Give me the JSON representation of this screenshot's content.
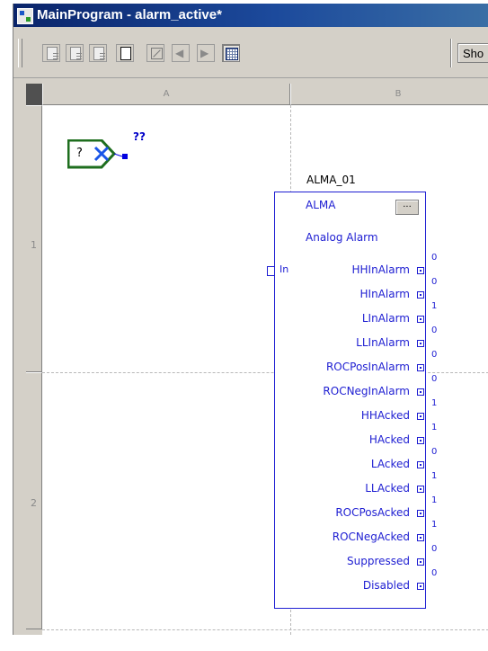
{
  "window": {
    "title": "MainProgram - alarm_active*"
  },
  "toolbar": {
    "show_label": "Sho"
  },
  "grid": {
    "columns": [
      "A",
      "B"
    ],
    "rows": [
      "1",
      "2"
    ]
  },
  "input_reference": {
    "value": "?",
    "tag_placeholder": "??"
  },
  "block": {
    "instance_name": "ALMA_01",
    "type": "ALMA",
    "ellipsis": "...",
    "description": "Analog Alarm",
    "input_pin": "In",
    "outputs": [
      {
        "label": "HHInAlarm",
        "value": "0"
      },
      {
        "label": "HInAlarm",
        "value": "0"
      },
      {
        "label": "LInAlarm",
        "value": "1"
      },
      {
        "label": "LLInAlarm",
        "value": "0"
      },
      {
        "label": "ROCPosInAlarm",
        "value": "0"
      },
      {
        "label": "ROCNegInAlarm",
        "value": "0"
      },
      {
        "label": "HHAcked",
        "value": "1"
      },
      {
        "label": "HAcked",
        "value": "1"
      },
      {
        "label": "LAcked",
        "value": "0"
      },
      {
        "label": "LLAcked",
        "value": "1"
      },
      {
        "label": "ROCPosAcked",
        "value": "1"
      },
      {
        "label": "ROCNegAcked",
        "value": "1"
      },
      {
        "label": "Suppressed",
        "value": "0"
      },
      {
        "label": "Disabled",
        "value": "0"
      }
    ]
  },
  "colors": {
    "title_bar": "#0a246a",
    "block_blue": "#1e1ed2",
    "reference_green": "#1e6e1e"
  }
}
